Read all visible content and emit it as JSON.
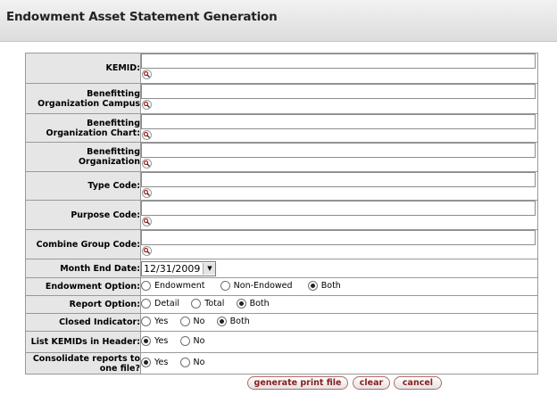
{
  "page": {
    "title": "Endowment Asset Statement Generation"
  },
  "fields": [
    {
      "label": "KEMID:",
      "value": ""
    },
    {
      "label": "Benefitting Organization Campus",
      "value": ""
    },
    {
      "label": "Benefitting Organization Chart:",
      "value": ""
    },
    {
      "label": "Benefitting Organization",
      "value": ""
    },
    {
      "label": "Type Code:",
      "value": ""
    },
    {
      "label": "Purpose Code:",
      "value": ""
    },
    {
      "label": "Combine Group Code:",
      "value": ""
    }
  ],
  "month_end": {
    "label": "Month End Date:",
    "value": "12/31/2009"
  },
  "endowment_option": {
    "label": "Endowment Option:",
    "options": [
      "Endowment",
      "Non-Endowed",
      "Both"
    ],
    "selected": "Both"
  },
  "report_option": {
    "label": "Report Option:",
    "options": [
      "Detail",
      "Total",
      "Both"
    ],
    "selected": "Both"
  },
  "closed_indicator": {
    "label": "Closed Indicator:",
    "options": [
      "Yes",
      "No",
      "Both"
    ],
    "selected": "Both"
  },
  "list_kemids": {
    "label": "List KEMIDs in Header:",
    "options": [
      "Yes",
      "No"
    ],
    "selected": "Yes"
  },
  "consolidate": {
    "label": "Consolidate reports to one file?",
    "options": [
      "Yes",
      "No"
    ],
    "selected": "Yes"
  },
  "buttons": {
    "generate": "generate print file",
    "clear": "clear",
    "cancel": "cancel"
  },
  "icons": {
    "lookup": "magnifier-icon",
    "dropdown": "chevron-down-icon"
  }
}
